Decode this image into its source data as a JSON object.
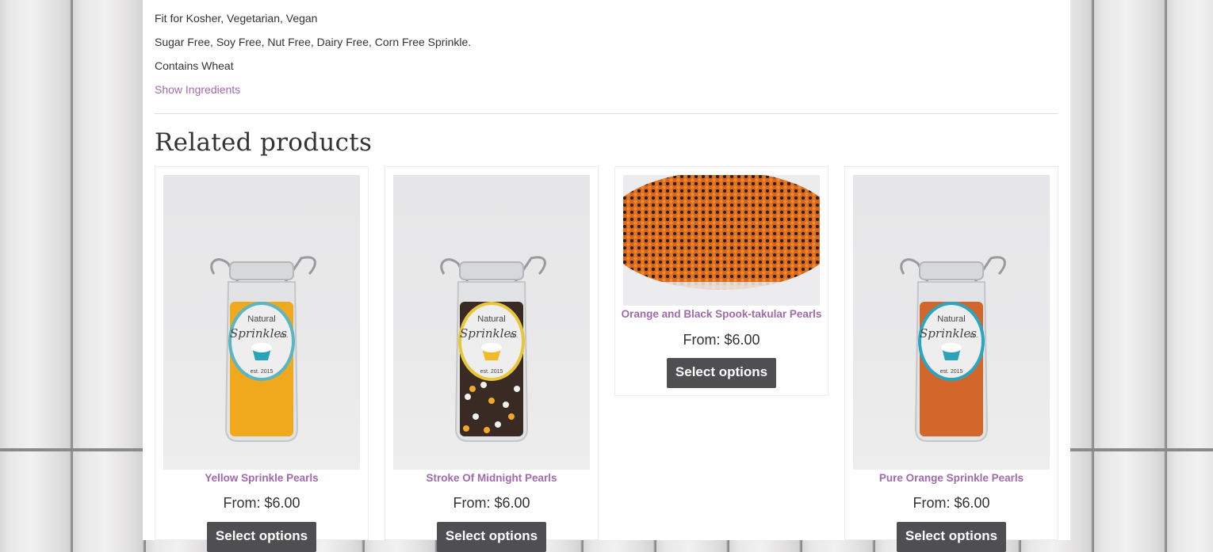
{
  "description": {
    "line1": "Fit for Kosher, Vegetarian, Vegan",
    "line2": "Sugar Free, Soy Free, Nut Free, Dairy Free, Corn Free Sprinkle.",
    "line3": "Contains Wheat",
    "show_ingredients": "Show Ingredients"
  },
  "related": {
    "title": "Related products",
    "products": [
      {
        "name": "Yellow Sprinkle Pearls",
        "price": "From: $6.00",
        "button": "Select options",
        "label_text_1": "Natural",
        "label_text_2": "Sprinkles",
        "label_text_3": "co.",
        "label_text_4": "est. 2015",
        "pearl_color": "#f0a81d",
        "label_ring": "#5ab5c4",
        "cupcake_color": "#2aa3b8"
      },
      {
        "name": "Stroke Of Midnight Pearls",
        "price": "From: $6.00",
        "button": "Select options",
        "label_text_1": "Natural",
        "label_text_2": "Sprinkles",
        "label_text_3": "co.",
        "label_text_4": "est. 2015",
        "pearl_color": "#3a2a24",
        "label_ring": "#e8c63a",
        "cupcake_color": "#f2b92a"
      },
      {
        "name": "Orange and Black Spook-takular Pearls",
        "price": "From: $6.00",
        "button": "Select options"
      },
      {
        "name": "Pure Orange Sprinkle Pearls",
        "price": "From: $6.00",
        "button": "Select options",
        "label_text_1": "Natural",
        "label_text_2": "Sprinkles",
        "label_text_3": "co.",
        "label_text_4": "est. 2015",
        "pearl_color": "#d3662a",
        "label_ring": "#2aa6c2",
        "cupcake_color": "#2aa3b8"
      }
    ]
  },
  "colors": {
    "link": "#a06aab",
    "button_bg": "#4f4f51",
    "orange_pearl": "#e8771f",
    "black_pearl": "#2b211c"
  }
}
